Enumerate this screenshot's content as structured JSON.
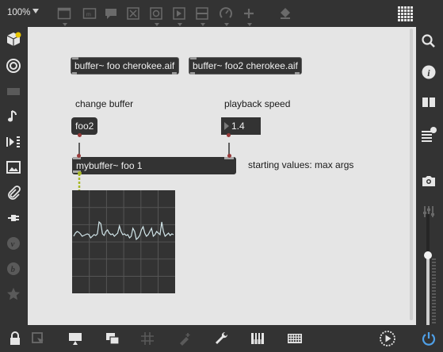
{
  "toolbar_top": {
    "zoom": "100%",
    "icons": [
      "patcher-window-icon",
      "presentation-icon",
      "comment-icon",
      "toggle-icon",
      "target-icon",
      "media-icon",
      "slider-icon",
      "dial-icon",
      "add-icon",
      "paint-bucket-icon",
      "grid-menu-icon"
    ]
  },
  "toolbar_left": {
    "icons": [
      "package-icon",
      "target-circles-icon",
      "keyboard-disabled-icon",
      "music-note-icon",
      "playlist-icon",
      "image-icon",
      "paperclip-icon",
      "plugin-icon",
      "vst-icon",
      "beat-icon",
      "star-icon"
    ]
  },
  "toolbar_right": {
    "icons": [
      "search-icon",
      "info-icon",
      "book-icon",
      "list-icon",
      "camera-icon",
      "mixer-icon"
    ]
  },
  "toolbar_bottom": {
    "icons": [
      "lock-icon",
      "edit-select-icon",
      "presentation-mode-icon",
      "windows-icon",
      "grid-icon",
      "snap-icon",
      "wrench-icon",
      "piano-icon",
      "keyboard-icon",
      "play-icon",
      "power-icon"
    ]
  },
  "patch": {
    "buffer1": "buffer~ foo cherokee.aif",
    "buffer2": "buffer~ foo2 cherokee.aif",
    "comment_change": "change buffer",
    "comment_speed": "playback speed",
    "message": "foo2",
    "number": "1.4",
    "mybuffer": "mybuffer~ foo 1",
    "comment_start": "starting values: max args"
  },
  "colors": {
    "chrome": "#333333",
    "canvas": "#e5e5e5",
    "object": "#333333",
    "accent": "#e7c500",
    "signal_patchcord": "#a7b826",
    "scope_trace": "#d2e6ea",
    "power": "#4fa0e8"
  }
}
